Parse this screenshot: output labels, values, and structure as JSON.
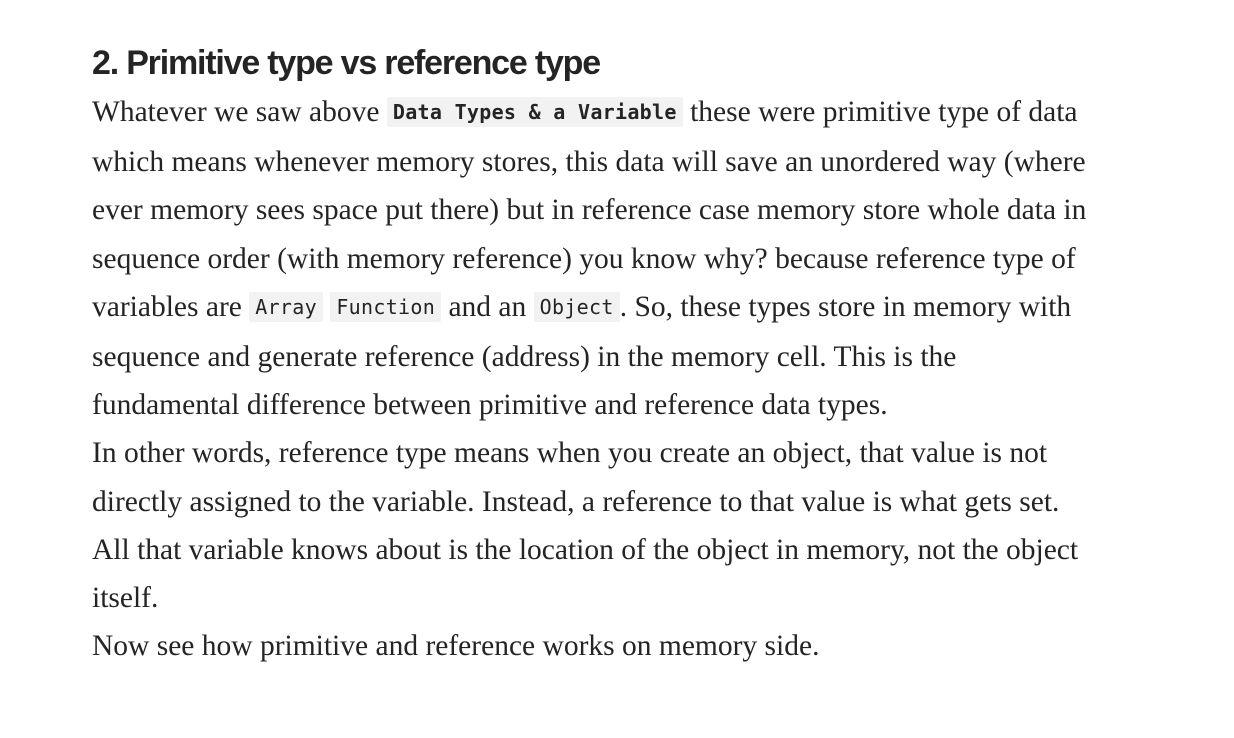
{
  "article": {
    "heading": "2. Primitive type vs reference type",
    "para1": {
      "t1": "Whatever we saw above ",
      "code1": "Data Types & a Variable",
      "t2": " these were primitive type of data which means whenever memory stores, this data will save an unordered way (where ever memory sees space put there) but in reference case memory store whole data in sequence order (with memory reference) you know why? because reference type of variables are ",
      "code2": "Array",
      "t3": " ",
      "code3": "Function",
      "t4": " and an ",
      "code4": "Object",
      "t5": ". So, these types store in memory with sequence and generate reference (address) in the memory cell. This is the fundamental difference between primitive and reference data types."
    },
    "para2": "In other words, reference type means when you create an object, that value is not directly assigned to the variable. Instead, a reference to that value is what gets set. All that variable knows about is the location of the object in memory, not the object itself.",
    "para3": "Now see how primitive and reference works on memory side."
  }
}
